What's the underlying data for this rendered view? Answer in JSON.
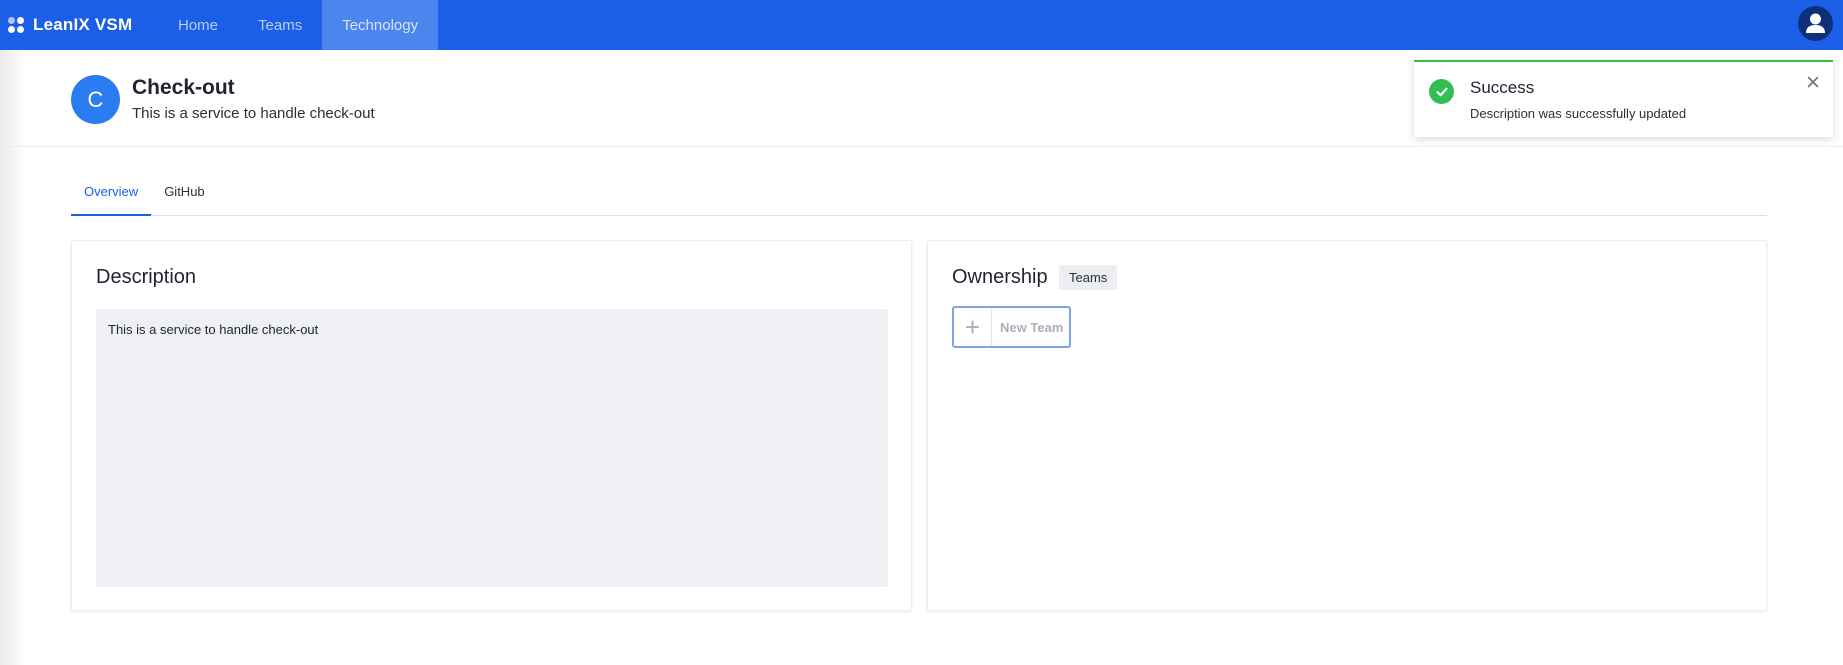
{
  "navbar": {
    "brand": "LeanIX VSM",
    "items": [
      {
        "label": "Home",
        "active": false
      },
      {
        "label": "Teams",
        "active": false
      },
      {
        "label": "Technology",
        "active": true
      }
    ],
    "avatar_icon": "user-icon"
  },
  "header": {
    "avatar_letter": "C",
    "title": "Check-out",
    "subtitle": "This is a service to handle check-out"
  },
  "tabs": [
    {
      "label": "Overview",
      "active": true
    },
    {
      "label": "GitHub",
      "active": false
    }
  ],
  "description_card": {
    "title": "Description",
    "text": "This is a service to handle check-out"
  },
  "ownership_card": {
    "title": "Ownership",
    "badge": "Teams",
    "new_team_label": "New Team"
  },
  "toast": {
    "title": "Success",
    "message": "Description was successfully updated",
    "icon": "check-circle-icon",
    "close_icon": "close-icon"
  },
  "colors": {
    "primary": "#1a5fe6",
    "success": "#2fbf52",
    "avatar": "#2b7cf0"
  }
}
